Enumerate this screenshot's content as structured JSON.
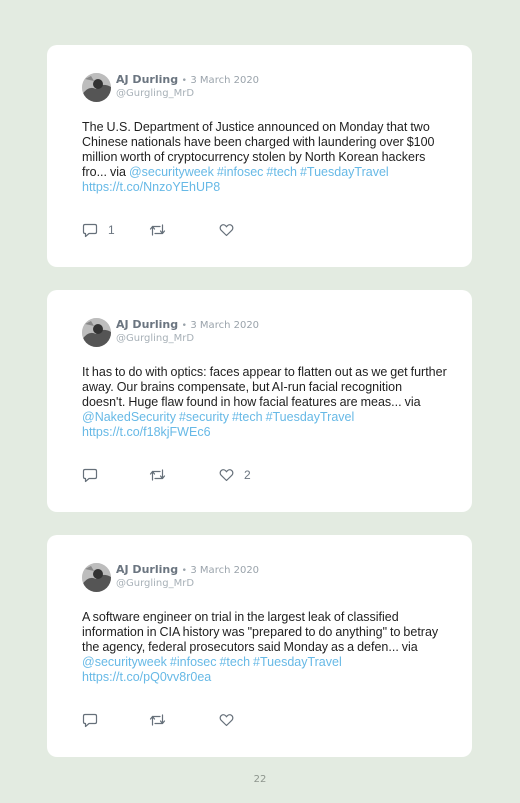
{
  "tweets": [
    {
      "author": "AJ Durling",
      "separator": "•",
      "date": "3 March 2020",
      "handle": "@Gurgling_MrD",
      "text": "The U.S. Department of Justice announced on Monday that two Chinese nationals have been charged with laundering over $100 million worth of cryptocurrency stolen by North Korean hackers fro... via ",
      "links": [
        "@securityweek",
        "#infosec",
        "#tech",
        "#TuesdayTravel",
        "https://t.co/NnzoYEhUP8"
      ],
      "reply_count": "1",
      "retweet_count": "",
      "like_count": ""
    },
    {
      "author": "AJ Durling",
      "separator": "•",
      "date": "3 March 2020",
      "handle": "@Gurgling_MrD",
      "text": "It has to do with optics: faces appear to flatten out as we get further away. Our brains compensate, but AI-run facial recognition doesn't. Huge flaw found in how facial features are meas... via ",
      "links": [
        "@NakedSecurity",
        "#security",
        "#tech",
        "#TuesdayTravel",
        "https://t.co/f18kjFWEc6"
      ],
      "reply_count": "",
      "retweet_count": "",
      "like_count": "2"
    },
    {
      "author": "AJ Durling",
      "separator": "•",
      "date": "3 March 2020",
      "handle": "@Gurgling_MrD",
      "text": "A software engineer on trial in the largest leak of classified information in CIA history was \"prepared to do anything\" to betray the agency, federal prosecutors said Monday as a defen... via ",
      "links": [
        "@securityweek",
        "#infosec",
        "#tech",
        "#TuesdayTravel",
        "https://t.co/pQ0vv8r0ea"
      ],
      "reply_count": "",
      "retweet_count": "",
      "like_count": ""
    }
  ],
  "page_number": "22",
  "colors": {
    "background": "#e3ebe1",
    "card": "#ffffff",
    "link": "#67b9e6",
    "author": "#6b7580",
    "meta": "#9aa3ab"
  },
  "icons": {
    "reply": "speech-bubble-icon",
    "retweet": "retweet-arrows-icon",
    "like": "heart-icon"
  }
}
